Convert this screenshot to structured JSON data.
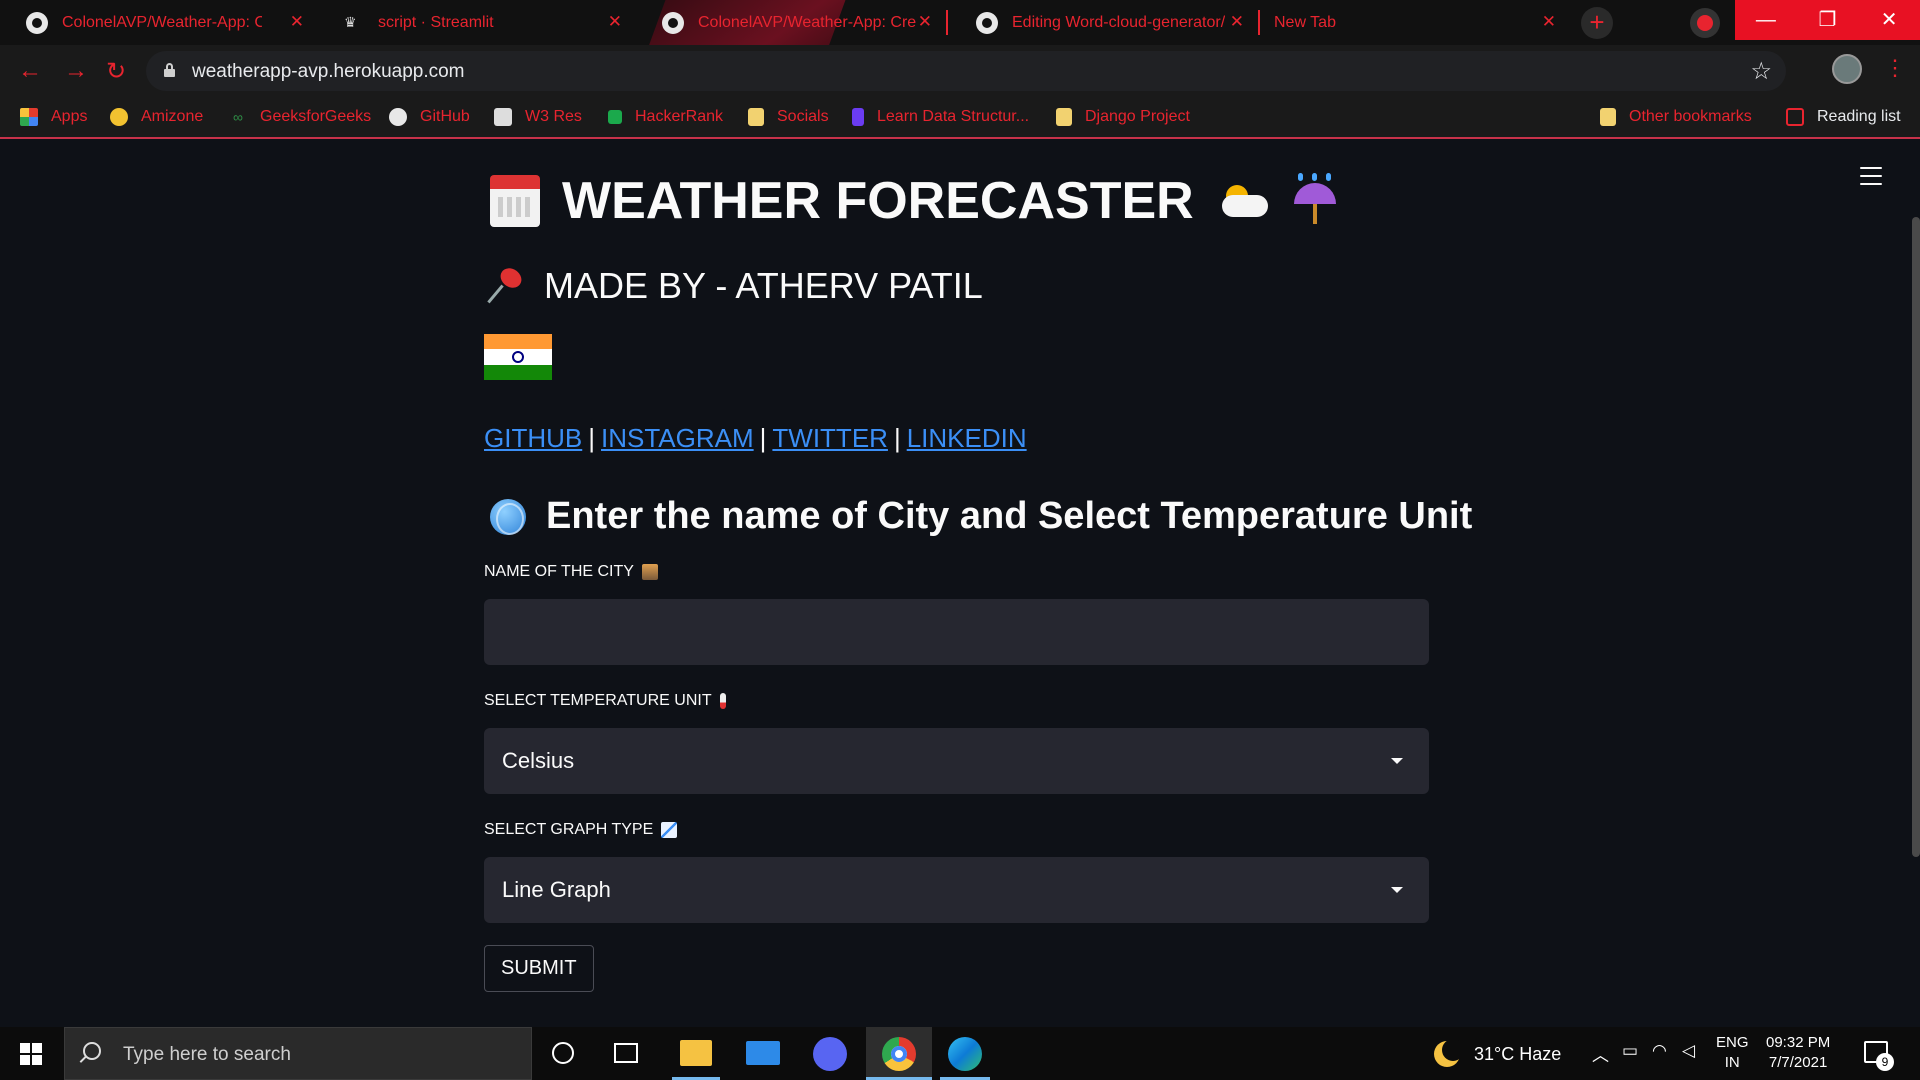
{
  "browser": {
    "tabs": [
      {
        "label": "ColonelAVP/Weather-App: Cre",
        "icon": "github-icon"
      },
      {
        "label": "script · Streamlit",
        "icon": "streamlit-crown-icon"
      },
      {
        "label": "ColonelAVP/Weather-App: Cre",
        "icon": "github-icon"
      },
      {
        "label": "Editing Word-cloud-generator/",
        "icon": "github-icon"
      },
      {
        "label": "New Tab",
        "icon": ""
      }
    ],
    "url": "weatherapp-avp.herokuapp.com",
    "bookmarks": [
      {
        "label": "Apps",
        "icon": "apps-grid-icon"
      },
      {
        "label": "Amizone",
        "icon": "amizone-icon"
      },
      {
        "label": "GeeksforGeeks",
        "icon": "geeksforgeeks-icon"
      },
      {
        "label": "GitHub",
        "icon": "github-icon"
      },
      {
        "label": "W3 Res",
        "icon": "w3resource-icon"
      },
      {
        "label": "HackerRank",
        "icon": "hackerrank-icon"
      },
      {
        "label": "Socials",
        "icon": "folder-icon"
      },
      {
        "label": "Learn Data Structur...",
        "icon": "learn-ds-icon"
      },
      {
        "label": "Django Project",
        "icon": "folder-icon"
      }
    ],
    "other_bookmarks": "Other bookmarks",
    "reading_list": "Reading list",
    "accent_color": "#e8242f"
  },
  "app": {
    "title": "WEATHER FORECASTER",
    "made_by": "MADE BY - ATHERV PATIL",
    "links": [
      {
        "label": "GITHUB"
      },
      {
        "label": "INSTAGRAM"
      },
      {
        "label": "TWITTER"
      },
      {
        "label": "LINKEDIN"
      }
    ],
    "link_separator": "|",
    "subheader": "Enter the name of City and Select Temperature Unit",
    "city_label": "NAME OF THE CITY",
    "city_value": "",
    "unit_label": "SELECT TEMPERATURE UNIT",
    "unit_value": "Celsius",
    "graph_label": "SELECT GRAPH TYPE",
    "graph_value": "Line Graph",
    "submit_label": "SUBMIT",
    "background_color": "#0e1117",
    "input_color": "#262730",
    "link_color": "#3b8ff6"
  },
  "taskbar": {
    "search_placeholder": "Type here to search",
    "weather": "31°C  Haze",
    "lang_line1": "ENG",
    "lang_line2": "IN",
    "time": "09:32 PM",
    "date": "7/7/2021",
    "notification_count": "9"
  }
}
